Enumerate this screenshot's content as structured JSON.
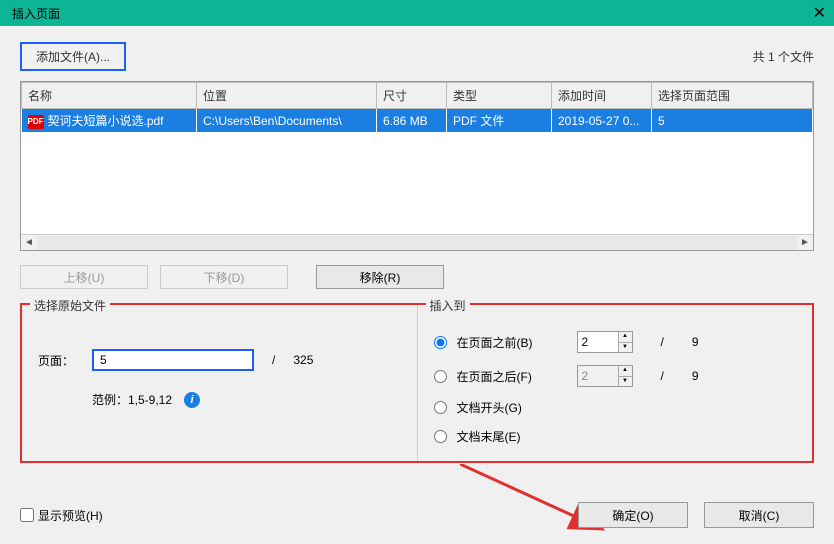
{
  "titlebar": {
    "title": "插入页面"
  },
  "top": {
    "add_file_label": "添加文件(A)...",
    "file_count": "共 1 个文件"
  },
  "table": {
    "headers": [
      "名称",
      "位置",
      "尺寸",
      "类型",
      "添加时间",
      "选择页面范围"
    ],
    "rows": [
      {
        "name": "契诃夫短篇小说选.pdf",
        "location": "C:\\Users\\Ben\\Documents\\",
        "size": "6.86 MB",
        "type": "PDF 文件",
        "added": "2019-05-27 0...",
        "range": "5"
      }
    ]
  },
  "buttons": {
    "move_up": "上移(U)",
    "move_down": "下移(D)",
    "remove": "移除(R)"
  },
  "left_group": {
    "title": "选择原始文件",
    "page_label": "页面：",
    "page_value": "5",
    "page_total": "325",
    "example_label": "范例：1,5-9,12"
  },
  "right_group": {
    "title": "插入到",
    "options": {
      "before": "在页面之前(B)",
      "after": "在页面之后(F)",
      "doc_start": "文档开头(G)",
      "doc_end": "文档末尾(E)"
    },
    "before_value": "2",
    "after_value": "2",
    "total": "9",
    "slash": "/"
  },
  "footer": {
    "preview_label": "显示预览(H)",
    "ok": "确定(O)",
    "cancel": "取消(C)"
  }
}
